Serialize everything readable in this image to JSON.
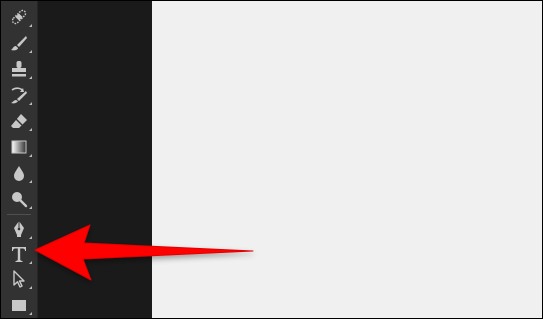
{
  "toolbar": {
    "tools": [
      {
        "name": "healing-brush",
        "icon": "bandage-icon"
      },
      {
        "name": "brush",
        "icon": "brush-icon"
      },
      {
        "name": "clone-stamp",
        "icon": "stamp-icon"
      },
      {
        "name": "history-brush",
        "icon": "history-brush-icon"
      },
      {
        "name": "eraser",
        "icon": "eraser-icon"
      },
      {
        "name": "gradient",
        "icon": "gradient-icon"
      },
      {
        "name": "blur",
        "icon": "drop-icon"
      },
      {
        "name": "dodge",
        "icon": "dodge-icon"
      },
      {
        "name": "pen",
        "icon": "pen-icon"
      },
      {
        "name": "type",
        "icon": "type-icon",
        "glyph": "T"
      },
      {
        "name": "path-selection",
        "icon": "arrow-cursor-icon"
      },
      {
        "name": "rectangle",
        "icon": "rectangle-icon"
      }
    ]
  },
  "annotation": {
    "color": "#ff0000",
    "target": "type tool"
  },
  "colors": {
    "toolbar": "#323232",
    "gutter": "#1a1a1a",
    "canvas": "#f0f0f0",
    "icon": "#c8c8c8"
  }
}
